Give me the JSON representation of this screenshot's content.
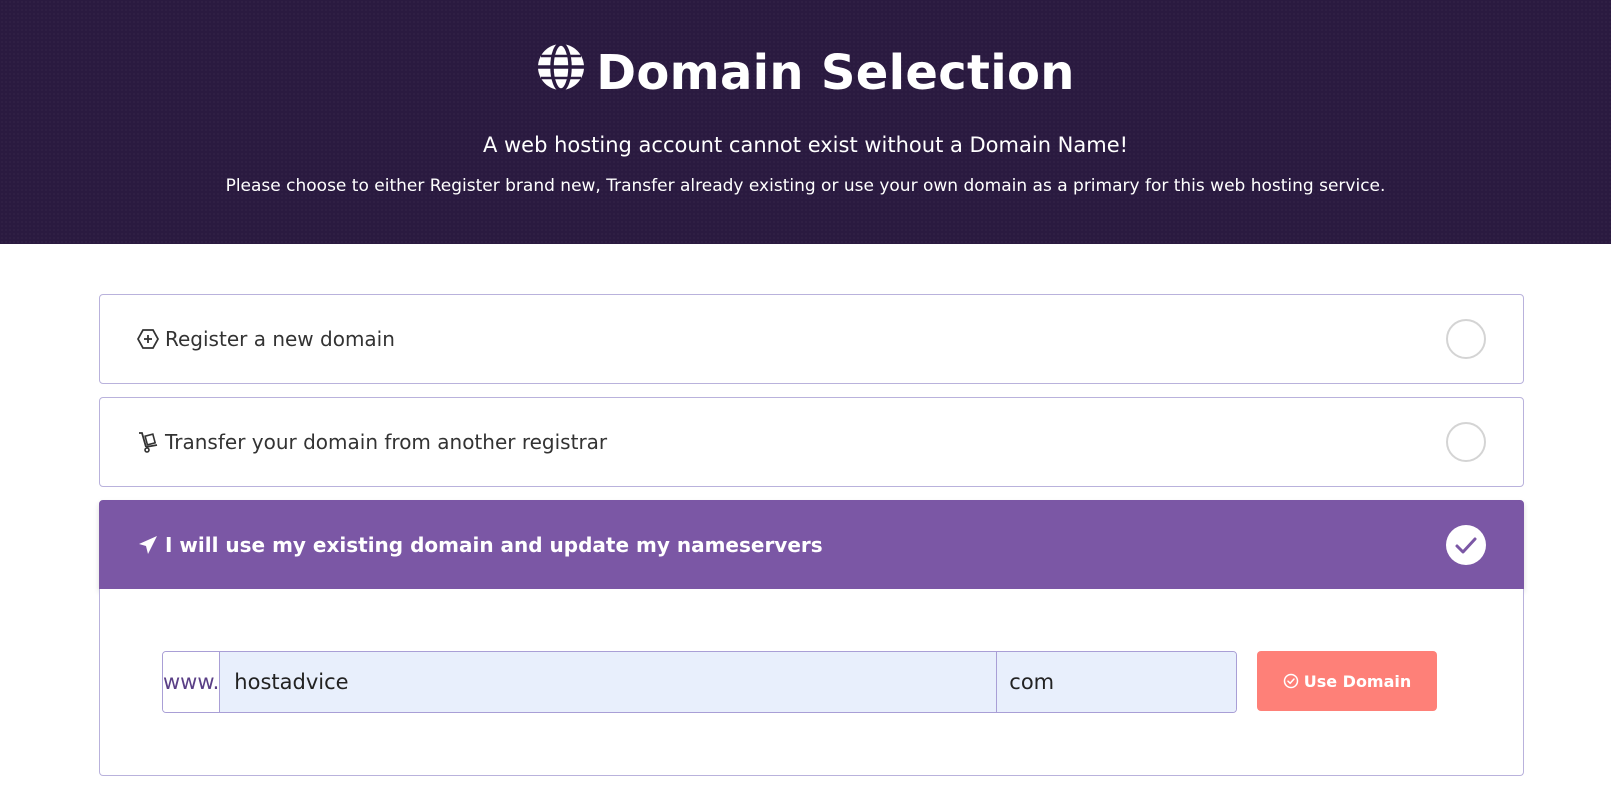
{
  "hero": {
    "title": "Domain Selection",
    "title_icon": "globe-icon",
    "subtitle": "A web hosting account cannot exist without a Domain Name!",
    "description": "Please choose to either Register brand new, Transfer already existing or use your own domain as a primary for this web hosting service."
  },
  "options": [
    {
      "label": "Register a new domain",
      "icon": "hexagon-plus-icon",
      "selected": false
    },
    {
      "label": "Transfer your domain from another registrar",
      "icon": "hand-truck-icon",
      "selected": false
    },
    {
      "label": "I will use my existing domain and update my nameservers",
      "icon": "paper-plane-icon",
      "selected": true
    }
  ],
  "domain_form": {
    "prefix": "www.",
    "domain_value": "hostadvice",
    "tld_value": "com",
    "button_label": "Use Domain",
    "button_icon": "check-circle-icon"
  },
  "colors": {
    "hero_bg": "#2a1a40",
    "selected_option": "#7b57a5",
    "button": "#fe8078",
    "input_bg": "#e8effc"
  }
}
